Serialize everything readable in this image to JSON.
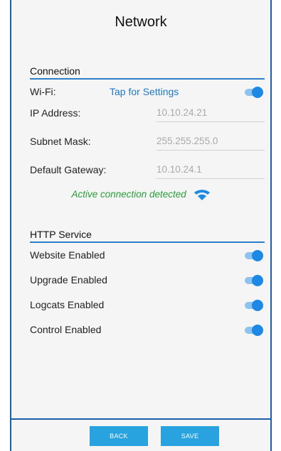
{
  "header": {
    "title": "Network"
  },
  "connection": {
    "section_label": "Connection",
    "wifi": {
      "label": "Wi-Fi:",
      "link_text": "Tap for Settings",
      "enabled": true
    },
    "ip_address": {
      "label": "IP Address:",
      "value": "10.10.24.21"
    },
    "subnet_mask": {
      "label": "Subnet Mask:",
      "value": "255.255.255.0"
    },
    "default_gateway": {
      "label": "Default Gateway:",
      "value": "10.10.24.1"
    },
    "status_text": "Active connection detected",
    "status_icon": "wifi-icon"
  },
  "http_service": {
    "section_label": "HTTP Service",
    "items": [
      {
        "label": "Website Enabled",
        "enabled": true
      },
      {
        "label": "Upgrade Enabled",
        "enabled": true
      },
      {
        "label": "Logcats Enabled",
        "enabled": true
      },
      {
        "label": "Control Enabled",
        "enabled": true
      }
    ]
  },
  "footer": {
    "back_label": "BACK",
    "save_label": "SAVE"
  },
  "colors": {
    "accent": "#1e88e5",
    "link": "#1f78c8",
    "status_green": "#2a9d3a",
    "button": "#29a3e0",
    "frame_border": "#1a5fa8"
  }
}
